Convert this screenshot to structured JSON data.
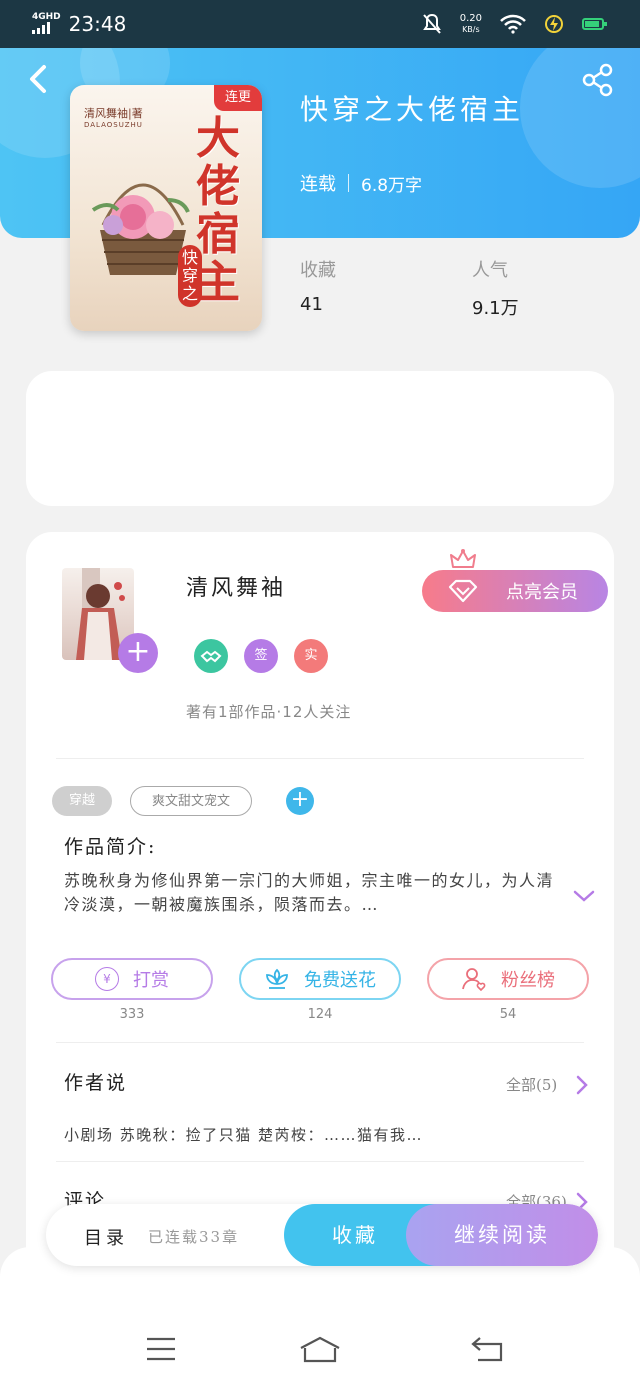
{
  "status_bar": {
    "network": "4GHD",
    "time": "23:48",
    "speed": "0.20",
    "speed_unit": "KB/s"
  },
  "book": {
    "title": "快穿之大佬宿主",
    "status": "连载",
    "words": "6.8万字",
    "cover": {
      "tag": "连更",
      "author_seal": "清风舞袖|著",
      "romanization": "DALAOSUZHU",
      "title_art": "大佬宿主",
      "prefix_art": "快穿之"
    }
  },
  "stats": {
    "favorites_label": "收藏",
    "favorites_value": "41",
    "popularity_label": "人气",
    "popularity_value": "9.1万"
  },
  "author": {
    "name": "清风舞袖",
    "badges": [
      "签",
      "实"
    ],
    "meta": "著有1部作品·12人关注",
    "vip_button": "点亮会员"
  },
  "tags": [
    "穿越",
    "爽文甜文宠文"
  ],
  "intro": {
    "heading": "作品简介:",
    "text": "苏晚秋身为修仙界第一宗门的大师姐，宗主唯一的女儿，为人清冷淡漠，一朝被魔族围杀，陨落而去。…"
  },
  "actions": [
    {
      "label": "打赏",
      "count": "333"
    },
    {
      "label": "免费送花",
      "count": "124"
    },
    {
      "label": "粉丝榜",
      "count": "54"
    }
  ],
  "author_says": {
    "heading": "作者说",
    "more": "全部(5)",
    "preview": "小剧场 苏晚秋：捡了只猫 楚芮桉：……猫有我…"
  },
  "comments": {
    "heading": "评论",
    "more": "全部(36)"
  },
  "bottom_bar": {
    "menu": "目录",
    "chapters": "已连载33章",
    "collect": "收藏",
    "continue": "继续阅读"
  },
  "colors": {
    "header": "#3aaef5",
    "accent_cyan": "#42c3ee",
    "accent_purple": "#b885e4",
    "accent_pink": "#f77b8a",
    "green_badge": "#3cc6a0"
  }
}
